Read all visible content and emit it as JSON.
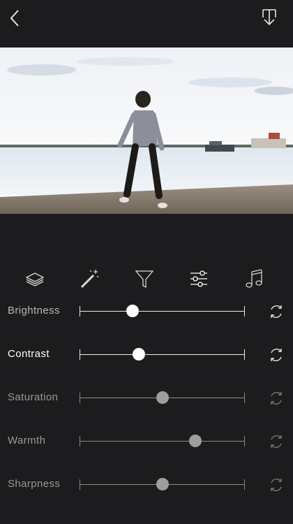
{
  "toolbar_icons": [
    "layers-icon",
    "magic-wand-icon",
    "filter-icon",
    "adjust-sliders-icon",
    "music-note-icon"
  ],
  "adjustments": [
    {
      "label": "Brightness",
      "value": 0.32,
      "state": "mid"
    },
    {
      "label": "Contrast",
      "value": 0.36,
      "state": "active"
    },
    {
      "label": "Saturation",
      "value": 0.5,
      "state": "dim"
    },
    {
      "label": "Warmth",
      "value": 0.7,
      "state": "dim"
    },
    {
      "label": "Sharpness",
      "value": 0.5,
      "state": "dim"
    }
  ]
}
